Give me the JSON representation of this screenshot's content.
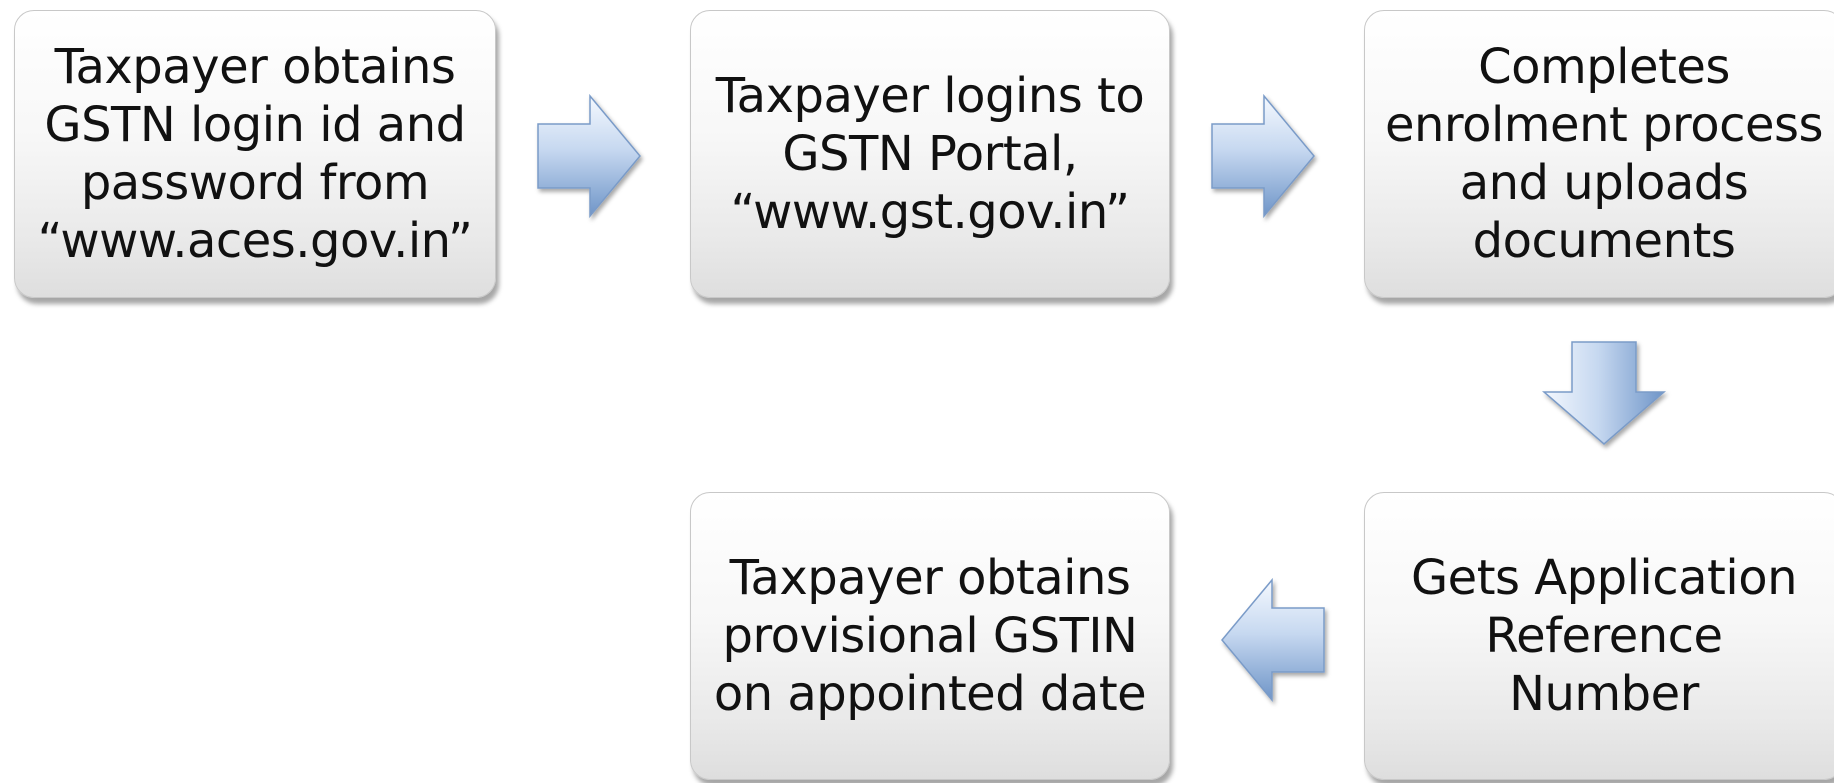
{
  "steps": [
    {
      "text": "Taxpayer obtains\nGSTN login id and\npassword from\n“www.aces.gov.in”"
    },
    {
      "text": "Taxpayer logins to\nGSTN Portal,\n“www.gst.gov.in”"
    },
    {
      "text": "Completes\nenrolment process\nand uploads\ndocuments"
    },
    {
      "text": "Gets Application\nReference\nNumber"
    },
    {
      "text": "Taxpayer obtains\nprovisional GSTIN\non appointed date"
    }
  ],
  "arrows": [
    {
      "direction": "right",
      "from": "step-1",
      "to": "step-2"
    },
    {
      "direction": "right",
      "from": "step-2",
      "to": "step-3"
    },
    {
      "direction": "down",
      "from": "step-3",
      "to": "step-4"
    },
    {
      "direction": "left",
      "from": "step-4",
      "to": "step-5"
    }
  ],
  "colors": {
    "box_top": "#ffffff",
    "box_bottom": "#dedede",
    "arrow_light": "#eef4fc",
    "arrow_dark": "#6f95c8",
    "text": "#111111"
  }
}
